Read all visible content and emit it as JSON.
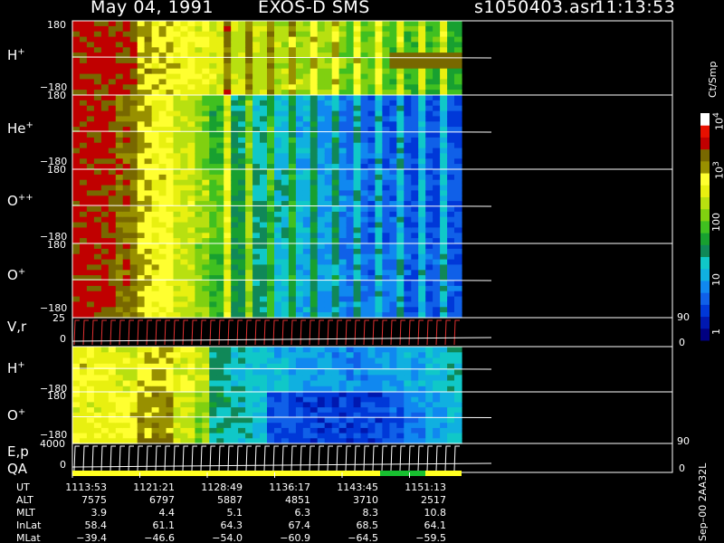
{
  "header": {
    "date": "May 04, 1991",
    "instrument": "EXOS-D SMS",
    "file": "s1050403.asr",
    "time": "11:13:53"
  },
  "colors": {
    "background": "#000000",
    "frame": "#ffffff",
    "trace": "#ffffff",
    "vel_trace": "#e03030"
  },
  "chart_data": {
    "type": "heatmap",
    "x_time_range": [
      "11:13:53",
      "11:51:13"
    ],
    "panels": [
      {
        "id": "hplus",
        "label_main": "H",
        "label_sup": "+",
        "y_top": "180",
        "y_bottom": "−180",
        "profile": [
          0.97,
          0.96,
          0.95,
          0.85,
          0.8,
          0.78,
          0.75,
          0.72,
          0.7,
          0.7,
          0.68,
          0.66,
          0.64,
          0.62,
          0.6,
          0.58,
          0.56,
          0.55,
          0.55,
          0.52
        ]
      },
      {
        "id": "heplus",
        "label_main": "He",
        "label_sup": "+",
        "y_top": "180",
        "y_bottom": "−180",
        "profile": [
          0.97,
          0.96,
          0.9,
          0.82,
          0.76,
          0.7,
          0.62,
          0.52,
          0.44,
          0.4,
          0.36,
          0.32,
          0.28,
          0.25,
          0.22,
          0.2,
          0.2,
          0.18,
          0.18,
          0.18
        ]
      },
      {
        "id": "opp",
        "label_main": "O",
        "label_sup": "++",
        "y_top": "180",
        "y_bottom": "−180",
        "profile": [
          0.97,
          0.96,
          0.9,
          0.82,
          0.78,
          0.72,
          0.66,
          0.58,
          0.48,
          0.42,
          0.38,
          0.34,
          0.3,
          0.26,
          0.22,
          0.2,
          0.2,
          0.18,
          0.18,
          0.18
        ]
      },
      {
        "id": "oplus",
        "label_main": "O",
        "label_sup": "+",
        "y_top": "180",
        "y_bottom": "−180",
        "profile": [
          0.97,
          0.96,
          0.9,
          0.82,
          0.78,
          0.7,
          0.62,
          0.54,
          0.46,
          0.4,
          0.36,
          0.32,
          0.3,
          0.26,
          0.24,
          0.22,
          0.22,
          0.2,
          0.2,
          0.2
        ]
      },
      {
        "id": "hplus2",
        "label_main": "H",
        "label_sup": "+",
        "y_top": "",
        "y_bottom": "−180",
        "profile": [
          0.78,
          0.75,
          0.72,
          0.8,
          0.82,
          0.74,
          0.7,
          0.42,
          0.38,
          0.36,
          0.34,
          0.32,
          0.3,
          0.28,
          0.26,
          0.28,
          0.3,
          0.32,
          0.36,
          0.4
        ]
      },
      {
        "id": "oplus2",
        "label_main": "O",
        "label_sup": "+",
        "y_top": "180",
        "y_bottom": "−180",
        "profile": [
          0.74,
          0.74,
          0.78,
          0.86,
          0.86,
          0.7,
          0.62,
          0.44,
          0.4,
          0.36,
          0.18,
          0.16,
          0.15,
          0.15,
          0.15,
          0.16,
          0.2,
          0.26,
          0.3,
          0.36
        ]
      }
    ],
    "line_panels": [
      {
        "id": "vr",
        "label": "V,r",
        "y_top": "25",
        "y_bottom": "0",
        "right_top": "90",
        "right_bottom": "0"
      },
      {
        "id": "ep",
        "label": "E,p",
        "label2": "QA",
        "y_top": "4000",
        "y_bottom": "0",
        "right_top": "90",
        "right_bottom": "0"
      }
    ],
    "colorbar": {
      "unit": "Ct/Smp",
      "ticks": [
        "1",
        "10",
        "100",
        "10",
        "10"
      ],
      "tick_sups": [
        "",
        "",
        "",
        "3",
        "4"
      ]
    }
  },
  "ephemeris": {
    "labels": [
      "UT",
      "ALT",
      "MLT",
      "InLat",
      "MLat"
    ],
    "columns": [
      {
        "ut": "1113:53",
        "alt": "7575",
        "mlt": "3.9",
        "inlat": "58.4",
        "mlat": "−39.4"
      },
      {
        "ut": "1121:21",
        "alt": "6797",
        "mlt": "4.4",
        "inlat": "61.1",
        "mlat": "−46.6"
      },
      {
        "ut": "1128:49",
        "alt": "5887",
        "mlt": "5.1",
        "inlat": "64.3",
        "mlat": "−54.0"
      },
      {
        "ut": "1136:17",
        "alt": "4851",
        "mlt": "6.3",
        "inlat": "67.4",
        "mlat": "−60.9"
      },
      {
        "ut": "1143:45",
        "alt": "3710",
        "mlt": "8.3",
        "inlat": "68.5",
        "mlat": "−64.5"
      },
      {
        "ut": "1151:13",
        "alt": "2517",
        "mlt": "10.8",
        "inlat": "64.1",
        "mlat": "−59.5"
      }
    ]
  },
  "footer_id": "Sep–00  2AA32L"
}
